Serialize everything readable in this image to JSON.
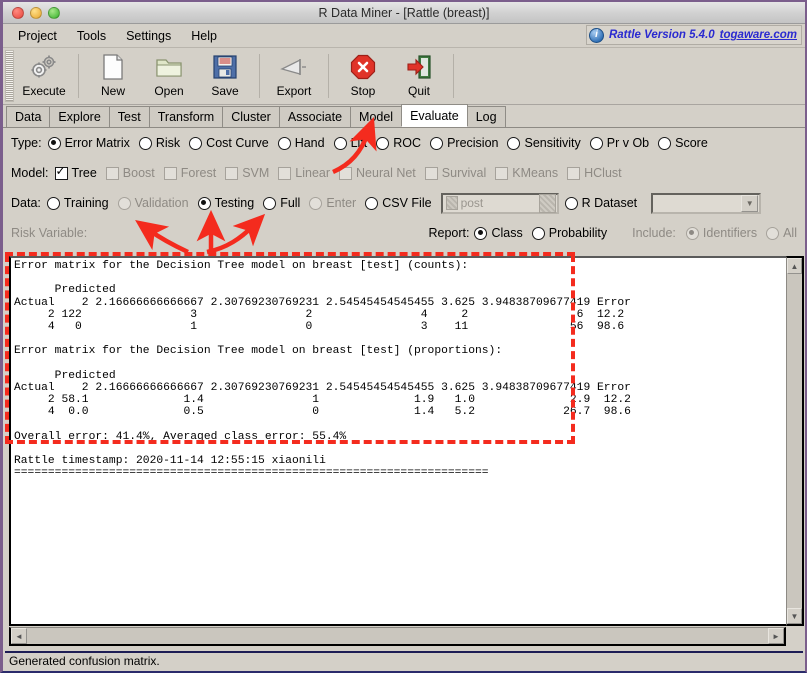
{
  "window": {
    "title": "R Data Miner - [Rattle (breast)]",
    "controls": [
      "close",
      "minimize",
      "maximize"
    ]
  },
  "menubar": {
    "items": [
      "Project",
      "Tools",
      "Settings",
      "Help"
    ],
    "version_label": "Rattle Version 5.4.0",
    "version_link": "togaware.com",
    "info_glyph": "i"
  },
  "toolbar": {
    "buttons": [
      {
        "label": "Execute",
        "icon": "gears-icon"
      },
      {
        "label": "New",
        "icon": "page-icon"
      },
      {
        "label": "Open",
        "icon": "folder-icon"
      },
      {
        "label": "Save",
        "icon": "floppy-disk-icon"
      },
      {
        "label": "Export",
        "icon": "export-icon"
      },
      {
        "label": "Stop",
        "icon": "stop-sign-icon"
      },
      {
        "label": "Quit",
        "icon": "exit-door-icon"
      }
    ]
  },
  "tabs": {
    "items": [
      "Data",
      "Explore",
      "Test",
      "Transform",
      "Cluster",
      "Associate",
      "Model",
      "Evaluate",
      "Log"
    ],
    "active": "Evaluate"
  },
  "type_row": {
    "label": "Type:",
    "options": [
      {
        "label": "Error Matrix",
        "selected": true,
        "enabled": true
      },
      {
        "label": "Risk",
        "selected": false,
        "enabled": true
      },
      {
        "label": "Cost Curve",
        "selected": false,
        "enabled": true
      },
      {
        "label": "Hand",
        "selected": false,
        "enabled": true
      },
      {
        "label": "Lift",
        "selected": false,
        "enabled": true
      },
      {
        "label": "ROC",
        "selected": false,
        "enabled": true
      },
      {
        "label": "Precision",
        "selected": false,
        "enabled": true
      },
      {
        "label": "Sensitivity",
        "selected": false,
        "enabled": true
      },
      {
        "label": "Pr v Ob",
        "selected": false,
        "enabled": true
      },
      {
        "label": "Score",
        "selected": false,
        "enabled": true
      }
    ]
  },
  "model_row": {
    "label": "Model:",
    "options": [
      {
        "label": "Tree",
        "checked": true,
        "enabled": true
      },
      {
        "label": "Boost",
        "checked": false,
        "enabled": false
      },
      {
        "label": "Forest",
        "checked": false,
        "enabled": false
      },
      {
        "label": "SVM",
        "checked": false,
        "enabled": false
      },
      {
        "label": "Linear",
        "checked": false,
        "enabled": false
      },
      {
        "label": "Neural Net",
        "checked": false,
        "enabled": false
      },
      {
        "label": "Survival",
        "checked": false,
        "enabled": false
      },
      {
        "label": "KMeans",
        "checked": false,
        "enabled": false
      },
      {
        "label": "HClust",
        "checked": false,
        "enabled": false
      }
    ]
  },
  "data_row": {
    "label": "Data:",
    "options": [
      {
        "label": "Training",
        "selected": false,
        "enabled": true
      },
      {
        "label": "Validation",
        "selected": false,
        "enabled": false
      },
      {
        "label": "Testing",
        "selected": true,
        "enabled": true
      },
      {
        "label": "Full",
        "selected": false,
        "enabled": true
      },
      {
        "label": "Enter",
        "selected": false,
        "enabled": false
      },
      {
        "label": "CSV File",
        "selected": false,
        "enabled": true
      }
    ],
    "csv_field_placeholder": "post",
    "r_dataset_label": "R Dataset",
    "r_dataset_value": "",
    "dropdown_arrow": "▼"
  },
  "risk_row": {
    "label": "Risk Variable:",
    "value": "",
    "report_label": "Report:",
    "report_options": [
      {
        "label": "Class",
        "selected": true,
        "enabled": true
      },
      {
        "label": "Probability",
        "selected": false,
        "enabled": true
      }
    ],
    "include_label": "Include:",
    "include_options": [
      {
        "label": "Identifiers",
        "selected": true,
        "enabled": false
      },
      {
        "label": "All",
        "selected": false,
        "enabled": false
      }
    ]
  },
  "output": {
    "text": "Error matrix for the Decision Tree model on breast [test] (counts):\n\n      Predicted\nActual    2 2.16666666666667 2.30769230769231 2.54545454545455 3.625 3.94838709677419 Error\n     2 122                3                2                4     2                6  12.2\n     4   0                1                0                3    11               56  98.6\n\nError matrix for the Decision Tree model on breast [test] (proportions):\n\n      Predicted\nActual    2 2.16666666666667 2.30769230769231 2.54545454545455 3.625 3.94838709677419 Error\n     2 58.1              1.4                1              1.9   1.0              2.9  12.2\n     4  0.0              0.5                0              1.4   5.2             26.7  98.6\n\nOverall error: 41.4%, Averaged class error: 55.4%\n\nRattle timestamp: 2020-11-14 12:55:15 xiaonili\n======================================================================"
  },
  "scrollbars": {
    "up_arrow": "▲",
    "down_arrow": "▼",
    "left_arrow": "◄",
    "right_arrow": "►"
  },
  "statusbar": {
    "message": "Generated confusion matrix."
  },
  "annotations": {
    "highlight_color": "#f42b1e",
    "arrow_targets": [
      "Evaluate tab",
      "Training radio",
      "Validation radio",
      "Testing radio"
    ],
    "box_region": "error matrix output"
  }
}
